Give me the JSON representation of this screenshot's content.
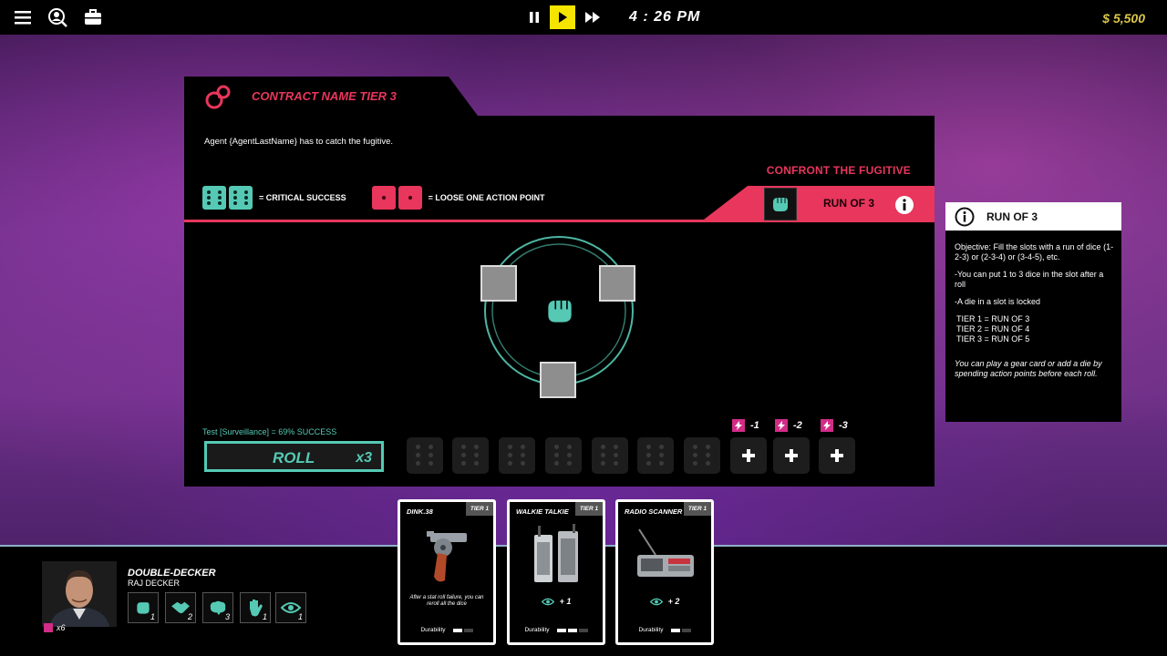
{
  "topbar": {
    "menu_icon": "hamburger-menu-icon",
    "agent_icon": "agent-search-icon",
    "inventory_icon": "briefcase-icon",
    "clock": "4 : 26 PM",
    "money": "$ 5,500",
    "money_color": "#d9c64a",
    "active_speed": "play"
  },
  "panel": {
    "contract_title": "CONTRACT NAME TIER 3",
    "agent_text": "Agent {AgentLastName} has to catch the fugitive.",
    "objective": "CONFRONT THE FUGITIVE",
    "legend_critical": "= CRITICAL SUCCESS",
    "legend_loose": "= LOOSE ONE ACTION POINT",
    "run_label": "RUN OF 3",
    "test_text": "Test [Surveillance] = 69% SUCCESS",
    "roll_label": "ROLL",
    "roll_count": "x3",
    "extra_costs": [
      "-1",
      "-2",
      "-3"
    ],
    "accent_red": "#e8365c",
    "accent_teal": "#55c9b4"
  },
  "tooltip": {
    "title": "RUN OF 3",
    "objective": "Objective: Fill the slots with a run of dice (1-2-3) or (2-3-4) or (3-4-5), etc.",
    "rule1": "-You can put 1 to 3 dice in the slot after a roll",
    "rule2": "-A die in a slot is locked",
    "tier1": "TIER 1 = RUN OF 3",
    "tier2": "TIER 2 = RUN OF 4",
    "tier3": "TIER 3 = RUN OF 5",
    "note": "You can play a gear card or add a die by spending action points before each roll."
  },
  "agent": {
    "codename": "DOUBLE-DECKER",
    "name": "RAJ DECKER",
    "action_points": "x6",
    "stats": [
      {
        "icon": "fist-icon",
        "value": "1"
      },
      {
        "icon": "handshake-icon",
        "value": "2"
      },
      {
        "icon": "brain-icon",
        "value": "3"
      },
      {
        "icon": "hand-icon",
        "value": "1"
      },
      {
        "icon": "eye-icon",
        "value": "1"
      }
    ]
  },
  "cards": [
    {
      "name": "DINK.38",
      "tier": "TIER 1",
      "desc": "After a stat roll failure, you can reroll all the dice",
      "durability_label": "Durability",
      "durability": 1
    },
    {
      "name": "WALKIE TALKIE",
      "tier": "TIER 1",
      "stat": "+ 1",
      "durability_label": "Durability",
      "durability": 2
    },
    {
      "name": "RADIO SCANNER",
      "tier": "TIER 1",
      "stat": "+ 2",
      "durability_label": "Durability",
      "durability": 1
    }
  ]
}
